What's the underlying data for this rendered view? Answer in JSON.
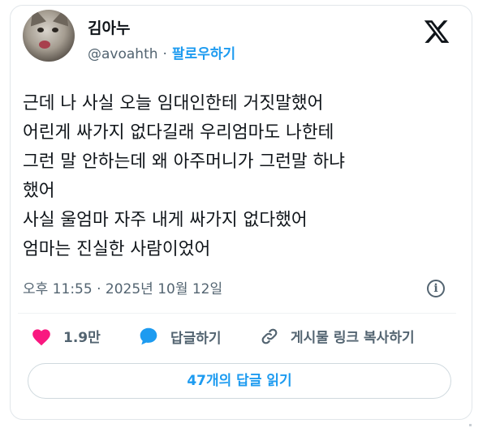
{
  "author": {
    "name": "김아누",
    "handle": "@avoahth",
    "separator": "·",
    "follow_label": "팔로우하기"
  },
  "tweet": {
    "text": "근데 나 사실 오늘 임대인한테 거짓말했어\n어린게 싸가지 없다길래 우리엄마도 나한테\n그런 말 안하는데 왜 아주머니가 그런말 하냐\n했어\n사실 울엄마 자주 내게 싸가지 없다했어\n엄마는 진실한 사람이었어",
    "timestamp": "오후 11:55 · 2025년 10월 12일"
  },
  "actions": {
    "likes": "1.9만",
    "reply_label": "답글하기",
    "copy_link_label": "게시물 링크 복사하기"
  },
  "read_replies_label": "47개의 답글 읽기",
  "colors": {
    "accent": "#1d9bf0",
    "like": "#f91880",
    "reply_icon": "#1d9bf0",
    "secondary_text": "#536471"
  }
}
